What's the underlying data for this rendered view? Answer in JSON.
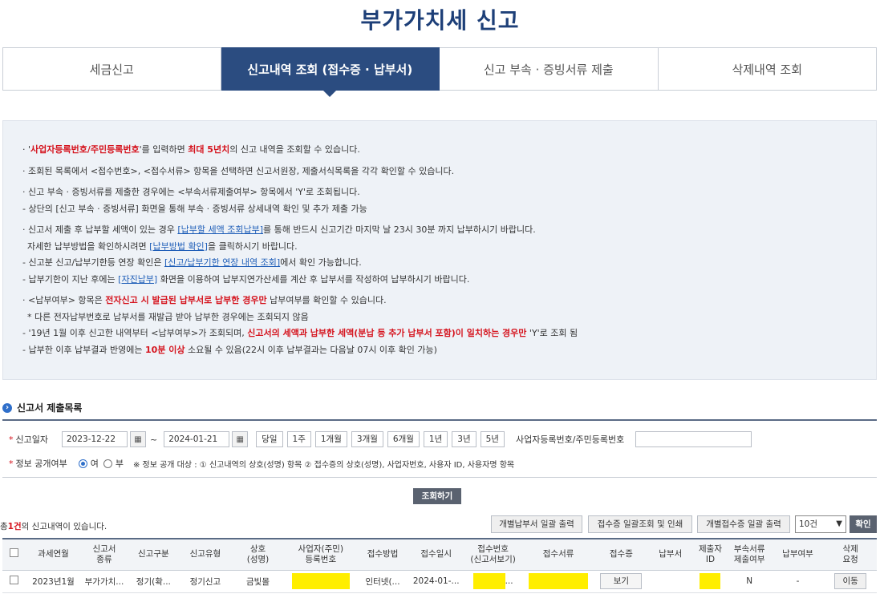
{
  "page": {
    "title": "부가가치세 신고"
  },
  "tabs": [
    {
      "label": "세금신고",
      "active": false
    },
    {
      "label": "신고내역 조회 (접수증 · 납부서)",
      "active": true
    },
    {
      "label": "신고 부속 · 증빙서류 제출",
      "active": false
    },
    {
      "label": "삭제내역 조회",
      "active": false
    }
  ],
  "info": {
    "l1_a": "· '",
    "l1_b": "사업자등록번호/주민등록번호",
    "l1_c": "'를 입력하면 ",
    "l1_d": "최대 5년치",
    "l1_e": "의 신고 내역을 조회할 수 있습니다.",
    "l2": "· 조회된 목록에서 <접수번호>, <접수서류> 항목을 선택하면 신고서원장, 제출서식목록을 각각 확인할 수 있습니다.",
    "l3": "· 신고 부속 · 증빙서류를 제출한 경우에는 <부속서류제출여부> 항목에서 'Y'로 조회됩니다.",
    "l4": "- 상단의 [신고 부속 · 증빙서류] 화면을 통해 부속 · 증빙서류 상세내역 확인 및 추가 제출 가능",
    "l5_a": "· 신고서 제출 후 납부할 세액이 있는 경우 ",
    "l5_link": "[납부할 세액 조회납부]",
    "l5_b": "를 통해 반드시 신고기간 마지막 날 23시 30분 까지 납부하시기 바랍니다.",
    "l6_a": "자세한 납부방법을 확인하시려면 ",
    "l6_link": "[납부방법 확인]",
    "l6_b": "을 클릭하시기 바랍니다.",
    "l7_a": "- 신고분 신고/납부기한등 연장 확인은 ",
    "l7_link": "[신고/납부기한 연장 내역 조회]",
    "l7_b": "에서 확인 가능합니다.",
    "l8_a": "- 납부기한이 지난 후에는 ",
    "l8_link": "[자진납부]",
    "l8_b": " 화면을 이용하여 납부지연가산세를 계산 후 납부서를 작성하여 납부하시기 바랍니다.",
    "l9_a": "· <납부여부> 항목은 ",
    "l9_b": "전자신고 시 발급된 납부서로 납부한 경우만",
    "l9_c": " 납부여부를 확인할 수 있습니다.",
    "l10": "* 다른 전자납부번호로 납부서를 재발급 받아 납부한 경우에는 조회되지 않음",
    "l11_a": "- '19년 1월 이후 신고한 내역부터 <납부여부>가 조회되며, ",
    "l11_b": "신고서의 세액과 납부한 세액(분납 등 추가 납부서 포함)이 일치하는 경우만",
    "l11_c": " 'Y'로 조회 됨",
    "l12_a": "- 납부한 이후 납부결과 반영에는 ",
    "l12_b": "10분 이상",
    "l12_c": " 소요될 수 있음(22시 이후 납부결과는 다음날 07시 이후 확인 가능)"
  },
  "section": {
    "title": "신고서 제출목록"
  },
  "search": {
    "req_mark": "*",
    "date_label": "신고일자",
    "date_from": "2023-12-22",
    "tilde": "~",
    "date_to": "2024-01-21",
    "periods": [
      "당일",
      "1주",
      "1개월",
      "3개월",
      "6개월",
      "1년",
      "3년",
      "5년"
    ],
    "biz_label": "사업자등록번호/주민등록번호",
    "public_label": "정보 공개여부",
    "opt_yes": "여",
    "opt_no": "부",
    "public_note": "※ 정보 공개 대상 : ① 신고내역의 상호(성명) 항목 ② 접수증의 상호(성명), 사업자번호, 사용자 ID, 사용자명 항목",
    "query_button": "조회하기"
  },
  "results": {
    "count_prefix": "총",
    "count": "1건",
    "count_suffix": "의 신고내역이 있습니다.",
    "btn_bill_print": "개별납부서 일괄 출력",
    "btn_receipt_print": "접수증 일괄조회 및 인쇄",
    "btn_indiv_receipt": "개별접수증 일괄 출력",
    "page_size": "10건",
    "confirm": "확인"
  },
  "table": {
    "headers": [
      {
        "l1": "과세연월",
        "l2": ""
      },
      {
        "l1": "신고서",
        "l2": "종류"
      },
      {
        "l1": "신고구분",
        "l2": ""
      },
      {
        "l1": "신고유형",
        "l2": ""
      },
      {
        "l1": "상호",
        "l2": "(성명)"
      },
      {
        "l1": "사업자(주민)",
        "l2": "등록번호"
      },
      {
        "l1": "접수방법",
        "l2": ""
      },
      {
        "l1": "접수일시",
        "l2": ""
      },
      {
        "l1": "접수번호",
        "l2": "(신고서보기)"
      },
      {
        "l1": "접수서류",
        "l2": ""
      },
      {
        "l1": "접수증",
        "l2": ""
      },
      {
        "l1": "납부서",
        "l2": ""
      },
      {
        "l1": "제출자",
        "l2": "ID"
      },
      {
        "l1": "부속서류",
        "l2": "제출여부"
      },
      {
        "l1": "납부여부",
        "l2": ""
      },
      {
        "l1": "삭제",
        "l2": "요청"
      }
    ],
    "row": {
      "period": "2023년1월",
      "form_type": "부가가치...",
      "report_kind": "정기(확...",
      "report_type": "정기신고",
      "name": "금빛몰",
      "method": "인터넷(...",
      "datetime": "2024-01-...",
      "receipt_no_suffix": "...",
      "view_btn": "보기",
      "attach": "N",
      "paid": "-",
      "move_btn": "이동"
    }
  },
  "colors": {
    "primary": "#2b4c80",
    "title": "#1d3f78",
    "red": "#d5141e",
    "link": "#1f5eb8",
    "highlight": "#ffee00"
  }
}
